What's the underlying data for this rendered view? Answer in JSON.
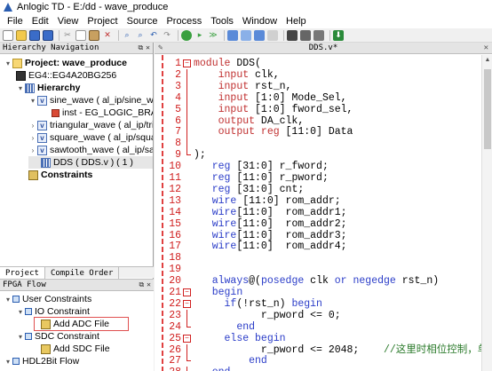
{
  "window": {
    "title": "Anlogic TD - E:/dd - wave_produce"
  },
  "menu": [
    "File",
    "Edit",
    "View",
    "Project",
    "Source",
    "Process",
    "Tools",
    "Window",
    "Help"
  ],
  "toolbar": {
    "buttons": [
      "new-file",
      "open-folder",
      "save",
      "save-all",
      "cut",
      "copy",
      "paste",
      "delete",
      "find",
      "find-replace",
      "undo",
      "redo",
      "run",
      "step",
      "run-all",
      "hierarchy",
      "netlist",
      "schematic",
      "pin-planner",
      "timing",
      "chip-view",
      "download"
    ]
  },
  "hierarchy": {
    "header": "Hierarchy Navigation",
    "project_label": "Project: wave_produce",
    "device": "EG4::EG4A20BG256",
    "hierarchy_label": "Hierarchy",
    "items": [
      {
        "label": "sine_wave ( al_ip/sine_wave",
        "child": "inst - EG_LOGIC_BRAM"
      },
      {
        "label": "triangular_wave ( al_ip/tria"
      },
      {
        "label": "square_wave ( al_ip/square"
      },
      {
        "label": "sawtooth_wave ( al_ip/saw"
      }
    ],
    "top_module": "DDS ( DDS.v ) ( 1 )",
    "constraints_label": "Constraints"
  },
  "tabs": [
    "Project",
    "Compile Order"
  ],
  "flow": {
    "header": "FPGA Flow",
    "items": [
      {
        "label": "User Constraints",
        "level": 0
      },
      {
        "label": "IO Constraint",
        "level": 1
      },
      {
        "label": "Add ADC File",
        "level": 2
      },
      {
        "label": "SDC Constraint",
        "level": 1
      },
      {
        "label": "Add SDC File",
        "level": 2
      },
      {
        "label": "HDL2Bit Flow",
        "level": 0
      }
    ]
  },
  "editor": {
    "tab_title": "DDS.v*",
    "lines": [
      {
        "n": "1",
        "fold": "box",
        "parts": [
          [
            "kw",
            "module "
          ],
          [
            "nm",
            "DDS("
          ]
        ]
      },
      {
        "n": "2",
        "fold": "line",
        "parts": [
          [
            "nm",
            "    "
          ],
          [
            "kw",
            "input "
          ],
          [
            "nm",
            "clk,"
          ]
        ]
      },
      {
        "n": "3",
        "fold": "line",
        "parts": [
          [
            "nm",
            "    "
          ],
          [
            "kw",
            "input "
          ],
          [
            "nm",
            "rst_n,"
          ]
        ]
      },
      {
        "n": "4",
        "fold": "line",
        "parts": [
          [
            "nm",
            "    "
          ],
          [
            "kw",
            "input "
          ],
          [
            "nm",
            "[1:0] Mode_Sel,"
          ]
        ]
      },
      {
        "n": "5",
        "fold": "line",
        "parts": [
          [
            "nm",
            "    "
          ],
          [
            "kw",
            "input "
          ],
          [
            "nm",
            "[1:0] fword_sel,"
          ]
        ]
      },
      {
        "n": "6",
        "fold": "line",
        "parts": [
          [
            "nm",
            "    "
          ],
          [
            "kw",
            "output "
          ],
          [
            "nm",
            "DA_clk,"
          ]
        ]
      },
      {
        "n": "7",
        "fold": "line",
        "parts": [
          [
            "nm",
            "    "
          ],
          [
            "kw",
            "output "
          ],
          [
            "kw",
            "reg "
          ],
          [
            "nm",
            "[11:0] Data"
          ]
        ]
      },
      {
        "n": "8",
        "fold": "line",
        "parts": []
      },
      {
        "n": "9",
        "fold": "end",
        "parts": [
          [
            "nm",
            ");"
          ]
        ]
      },
      {
        "n": "10",
        "fold": "",
        "parts": [
          [
            "nm",
            "   "
          ],
          [
            "kw2",
            "reg "
          ],
          [
            "nm",
            "[31:0] r_fword;"
          ]
        ]
      },
      {
        "n": "11",
        "fold": "",
        "parts": [
          [
            "nm",
            "   "
          ],
          [
            "kw2",
            "reg "
          ],
          [
            "nm",
            "[11:0] r_pword;"
          ]
        ]
      },
      {
        "n": "12",
        "fold": "",
        "parts": [
          [
            "nm",
            "   "
          ],
          [
            "kw2",
            "reg "
          ],
          [
            "nm",
            "[31:0] cnt;"
          ]
        ]
      },
      {
        "n": "13",
        "fold": "",
        "parts": [
          [
            "nm",
            "   "
          ],
          [
            "kw2",
            "wire "
          ],
          [
            "nm",
            "[11:0] rom_addr;"
          ]
        ]
      },
      {
        "n": "14",
        "fold": "",
        "parts": [
          [
            "nm",
            "   "
          ],
          [
            "kw2",
            "wire"
          ],
          [
            "nm",
            "[11:0]  rom_addr1;"
          ]
        ]
      },
      {
        "n": "15",
        "fold": "",
        "parts": [
          [
            "nm",
            "   "
          ],
          [
            "kw2",
            "wire"
          ],
          [
            "nm",
            "[11:0]  rom_addr2;"
          ]
        ]
      },
      {
        "n": "16",
        "fold": "",
        "parts": [
          [
            "nm",
            "   "
          ],
          [
            "kw2",
            "wire"
          ],
          [
            "nm",
            "[11:0]  rom_addr3;"
          ]
        ]
      },
      {
        "n": "17",
        "fold": "",
        "parts": [
          [
            "nm",
            "   "
          ],
          [
            "kw2",
            "wire"
          ],
          [
            "nm",
            "[11:0]  rom_addr4;"
          ]
        ]
      },
      {
        "n": "18",
        "fold": "",
        "parts": []
      },
      {
        "n": "19",
        "fold": "",
        "parts": []
      },
      {
        "n": "20",
        "fold": "",
        "parts": [
          [
            "nm",
            "   "
          ],
          [
            "kw2",
            "always"
          ],
          [
            "nm",
            "@("
          ],
          [
            "kw2",
            "posedge "
          ],
          [
            "nm",
            "clk "
          ],
          [
            "kw2",
            "or "
          ],
          [
            "kw2",
            "negedge "
          ],
          [
            "nm",
            "rst_n)"
          ]
        ]
      },
      {
        "n": "21",
        "fold": "box",
        "parts": [
          [
            "nm",
            "   "
          ],
          [
            "kw2",
            "begin"
          ]
        ]
      },
      {
        "n": "22",
        "fold": "box",
        "parts": [
          [
            "nm",
            "     "
          ],
          [
            "kw2",
            "if"
          ],
          [
            "nm",
            "(!rst_n) "
          ],
          [
            "kw2",
            "begin"
          ]
        ]
      },
      {
        "n": "23",
        "fold": "line",
        "parts": [
          [
            "nm",
            "           r_pword <= 0;"
          ]
        ]
      },
      {
        "n": "24",
        "fold": "end",
        "parts": [
          [
            "nm",
            "       "
          ],
          [
            "kw2",
            "end"
          ]
        ]
      },
      {
        "n": "25",
        "fold": "box",
        "parts": [
          [
            "nm",
            "     "
          ],
          [
            "kw2",
            "else "
          ],
          [
            "kw2",
            "begin"
          ]
        ]
      },
      {
        "n": "26",
        "fold": "line",
        "parts": [
          [
            "nm",
            "           r_pword <= 2048;    "
          ],
          [
            "cm",
            "//这里时相位控制，单步"
          ]
        ]
      },
      {
        "n": "27",
        "fold": "end",
        "parts": [
          [
            "nm",
            "         "
          ],
          [
            "kw2",
            "end"
          ]
        ]
      },
      {
        "n": "28",
        "fold": "end",
        "parts": [
          [
            "nm",
            "   "
          ],
          [
            "kw2",
            "end"
          ]
        ]
      }
    ]
  },
  "colors": {
    "keyword_io": "#c03030",
    "keyword_decl": "#2a3cc8",
    "comment": "#2a7a2a",
    "line_number": "#d02020",
    "selection_box": "#e05050"
  }
}
